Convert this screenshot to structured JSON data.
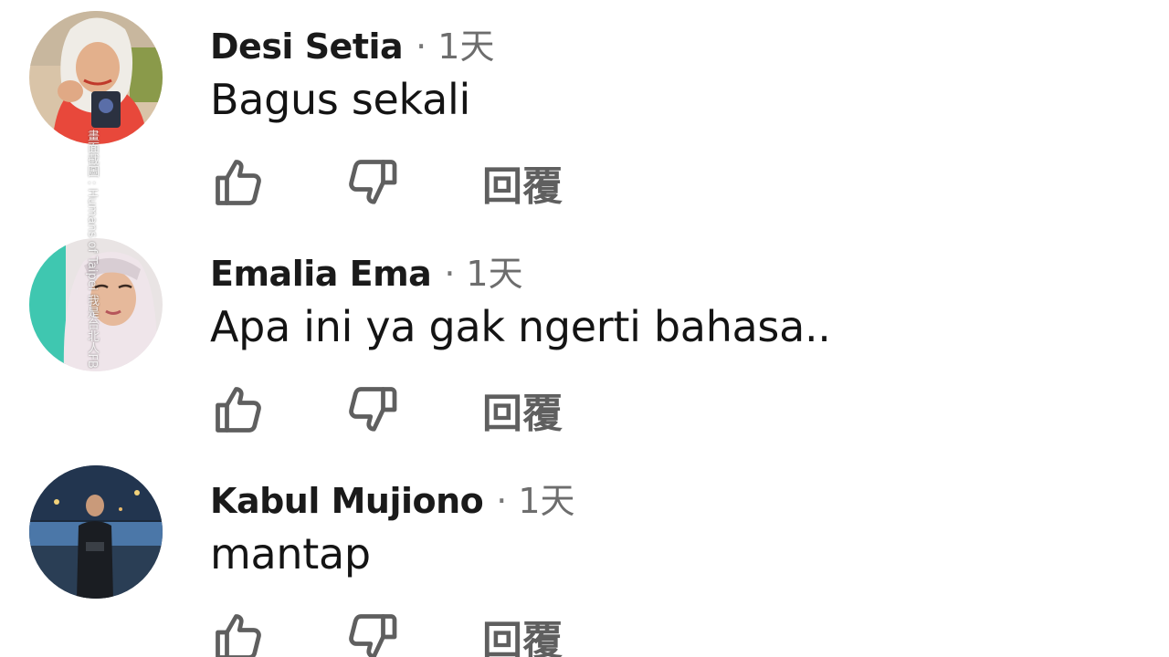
{
  "reply_label": "回覆",
  "watermark": "畫面截圖 : Humans of Taipei 我是台北人FB",
  "comments": [
    {
      "author": "Desi Setia",
      "separator": "·",
      "time": "1天",
      "text": "Bagus sekali"
    },
    {
      "author": "Emalia Ema",
      "separator": "·",
      "time": "1天",
      "text": "Apa ini ya gak ngerti bahasa.."
    },
    {
      "author": "Kabul Mujiono",
      "separator": "·",
      "time": "1天",
      "text": "mantap"
    }
  ],
  "icons": {
    "like": "thumbs-up-icon",
    "dislike": "thumbs-down-icon"
  },
  "colors": {
    "icon_stroke": "#5f5f5f",
    "author": "#1a1a1a",
    "meta": "#6d6d6d",
    "background": "#ffffff"
  }
}
